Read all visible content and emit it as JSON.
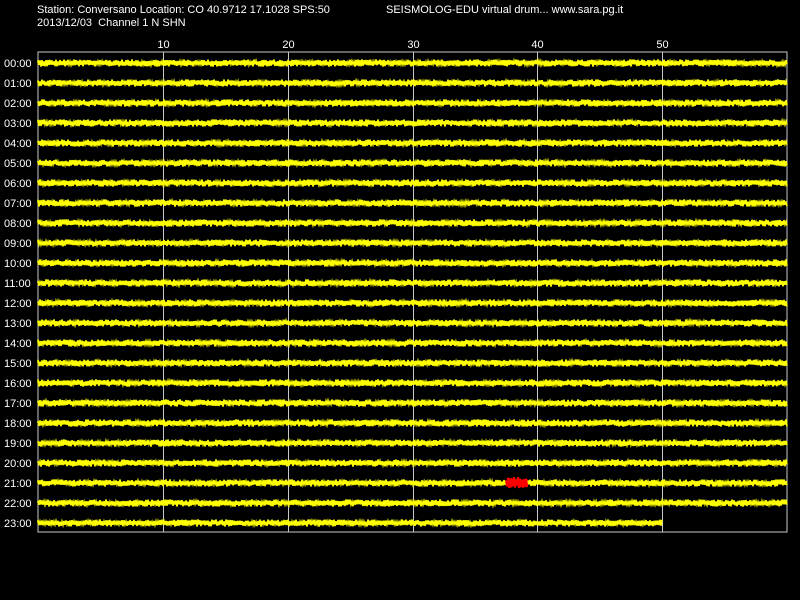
{
  "header": {
    "station_line": "Station: Conversano Location: CO 40.9712 17.1028 SPS:50",
    "date_line": "2013/12/03  Channel 1 N SHN",
    "site_line": "SEISMOLOG-EDU virtual drum... www.sara.pg.it"
  },
  "minute_ticks": [
    "10",
    "20",
    "30",
    "40",
    "50"
  ],
  "hour_labels": [
    "00:00",
    "01:00",
    "02:00",
    "03:00",
    "04:00",
    "05:00",
    "06:00",
    "07:00",
    "08:00",
    "09:00",
    "10:00",
    "11:00",
    "12:00",
    "13:00",
    "14:00",
    "15:00",
    "16:00",
    "17:00",
    "18:00",
    "19:00",
    "20:00",
    "21:00",
    "22:00",
    "23:00"
  ],
  "colors": {
    "background": "#000000",
    "trace": "#ffff00",
    "event": "#ff0000",
    "grid": "#c8c8c8",
    "text": "#ffffff"
  },
  "traces": {
    "last_trace_end_minute": 50,
    "event": {
      "hour": "21:00",
      "start_minute": 37.5,
      "end_minute": 39.2
    }
  }
}
